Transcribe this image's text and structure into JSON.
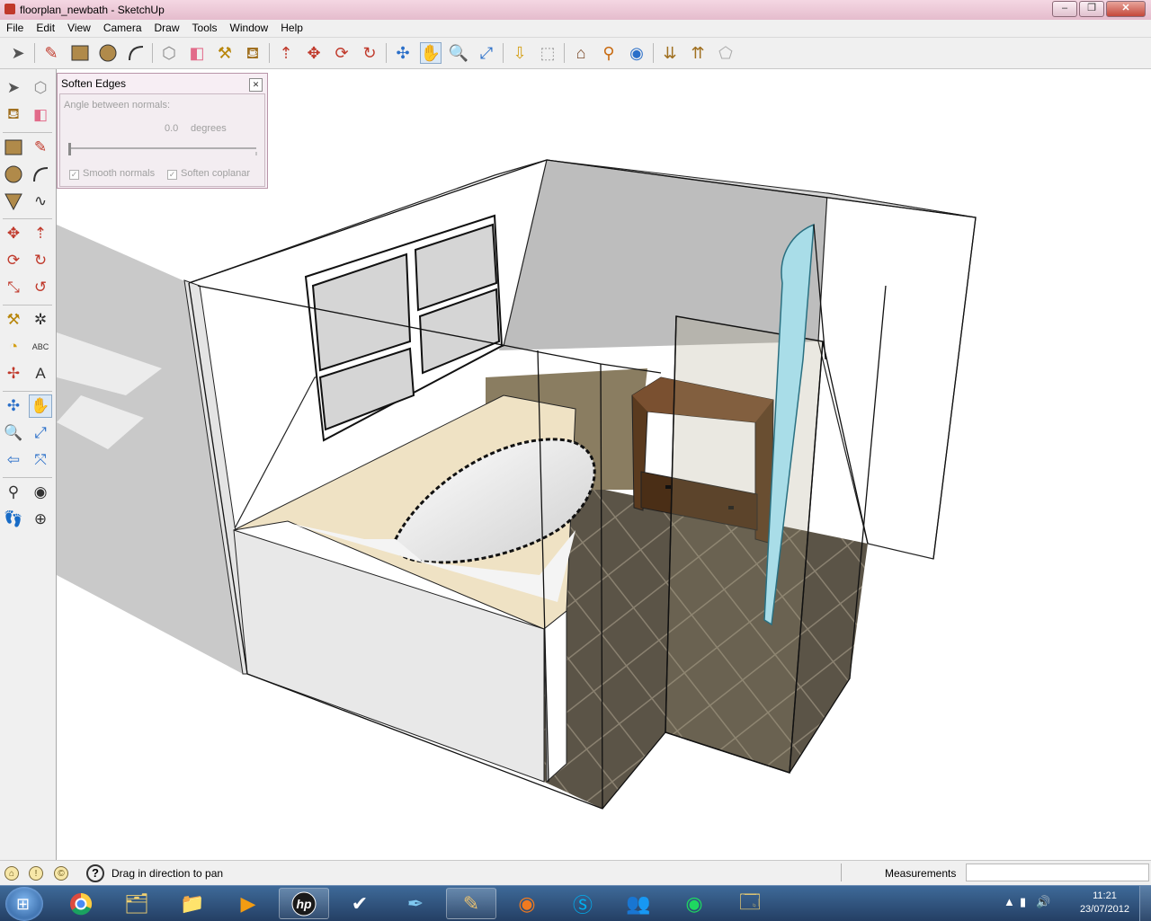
{
  "window": {
    "title": "floorplan_newbath - SketchUp",
    "controls": [
      "–",
      "❐",
      "✕"
    ]
  },
  "menu": [
    "File",
    "Edit",
    "View",
    "Camera",
    "Draw",
    "Tools",
    "Window",
    "Help"
  ],
  "dialog": {
    "title": "Soften Edges",
    "angle_label": "Angle between normals:",
    "angle_value": "0.0",
    "angle_unit": "degrees",
    "angle_slider_fraction": 0,
    "smooth_normals": {
      "label": "Smooth normals",
      "checked": true
    },
    "soften_coplanar": {
      "label": "Soften coplanar",
      "checked": true
    }
  },
  "status": {
    "hint": "Drag in direction to pan",
    "measurements_label": "Measurements",
    "measurements_value": ""
  },
  "clock": {
    "time": "11:21",
    "date": "23/07/2012"
  },
  "colors": {
    "window_frame": "#e8c4d4",
    "selection": "#1a1a1a",
    "tile": "#5d564a",
    "wood": "#5a3a1e",
    "glass": "#a9dde8"
  }
}
